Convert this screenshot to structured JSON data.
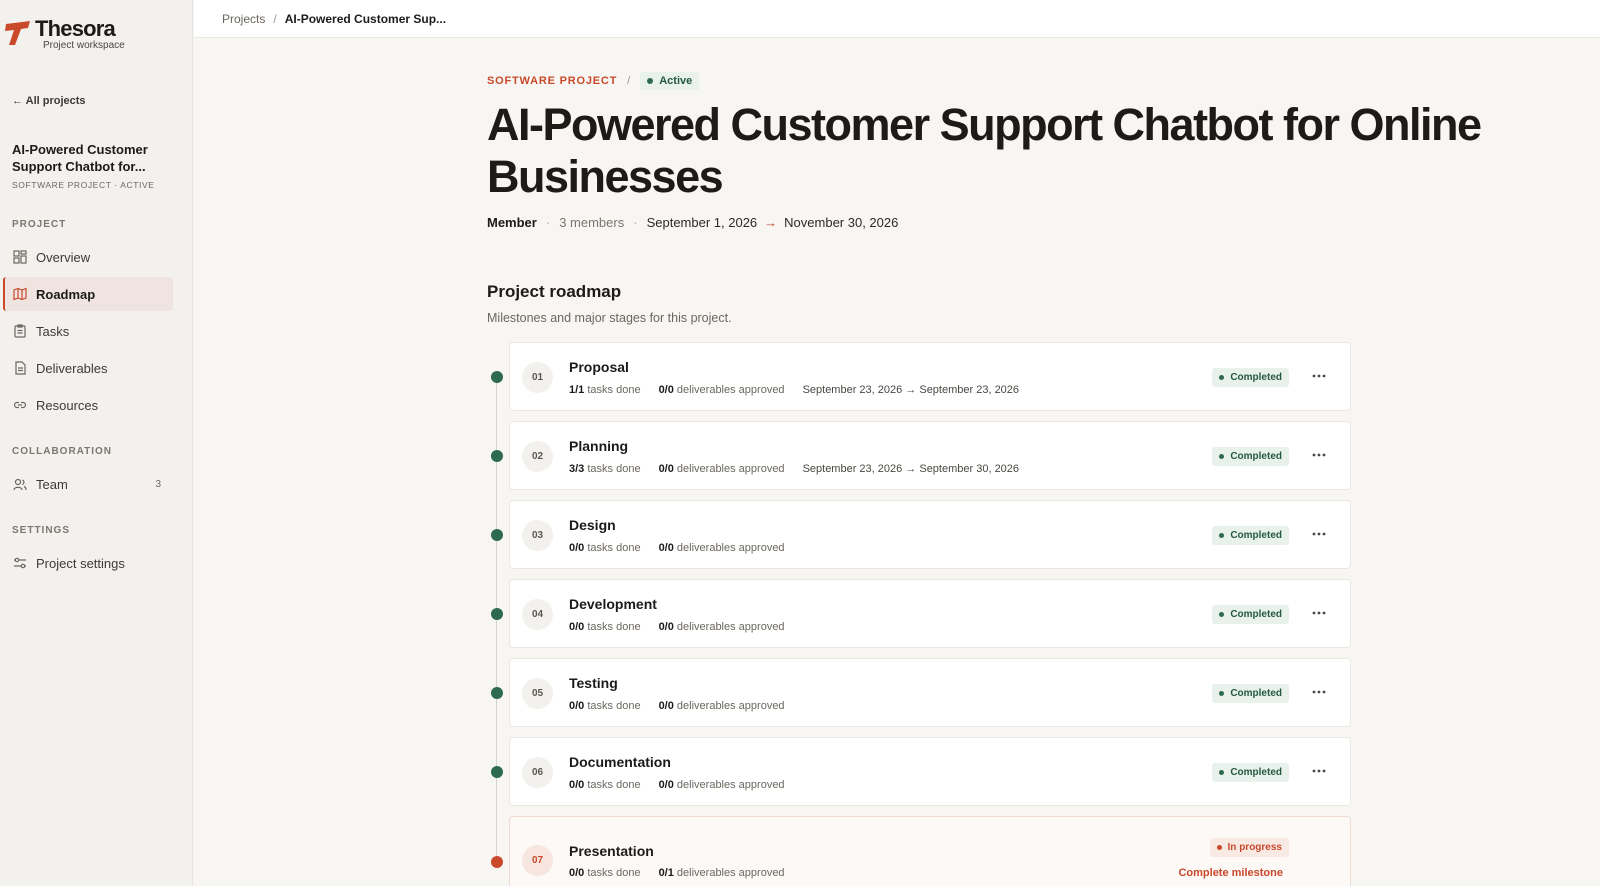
{
  "brand": {
    "name": "Thesora",
    "subtitle": "Project workspace",
    "accent": "#c9492b"
  },
  "sidebar": {
    "back_label": "← All projects",
    "project_title": "AI-Powered Customer Support Chatbot for...",
    "project_meta": "SOFTWARE PROJECT · ACTIVE",
    "sections": {
      "project": "PROJECT",
      "collaboration": "COLLABORATION",
      "settings": "SETTINGS"
    },
    "items": {
      "overview": "Overview",
      "roadmap": "Roadmap",
      "tasks": "Tasks",
      "deliverables": "Deliverables",
      "resources": "Resources",
      "team": "Team",
      "team_count": "3",
      "project_settings": "Project settings"
    }
  },
  "breadcrumb": {
    "root": "Projects",
    "separator": "/",
    "current": "AI-Powered Customer Sup..."
  },
  "header": {
    "type": "SOFTWARE PROJECT",
    "separator": "/",
    "status": "Active",
    "title": "AI-Powered Customer Support Chatbot for Online Businesses",
    "role": "Member",
    "members": "3 members",
    "start_date": "September 1, 2026",
    "arrow": "→",
    "end_date": "November 30, 2026"
  },
  "roadmap": {
    "title": "Project roadmap",
    "subtitle": "Milestones and major stages for this project.",
    "tasks_suffix": "tasks done",
    "deliverables_suffix": "deliverables approved",
    "complete_label": "Complete milestone",
    "milestones": [
      {
        "num": "01",
        "title": "Proposal",
        "tasks": "1/1",
        "deliverables": "0/0",
        "dates": "September 23, 2026 → September 23, 2026",
        "status": "Completed"
      },
      {
        "num": "02",
        "title": "Planning",
        "tasks": "3/3",
        "deliverables": "0/0",
        "dates": "September 23, 2026 → September 30, 2026",
        "status": "Completed"
      },
      {
        "num": "03",
        "title": "Design",
        "tasks": "0/0",
        "deliverables": "0/0",
        "dates": "",
        "status": "Completed"
      },
      {
        "num": "04",
        "title": "Development",
        "tasks": "0/0",
        "deliverables": "0/0",
        "dates": "",
        "status": "Completed"
      },
      {
        "num": "05",
        "title": "Testing",
        "tasks": "0/0",
        "deliverables": "0/0",
        "dates": "",
        "status": "Completed"
      },
      {
        "num": "06",
        "title": "Documentation",
        "tasks": "0/0",
        "deliverables": "0/0",
        "dates": "",
        "status": "Completed"
      },
      {
        "num": "07",
        "title": "Presentation",
        "tasks": "0/0",
        "deliverables": "0/1",
        "dates": "",
        "status": "In progress"
      }
    ]
  },
  "colors": {
    "completed": "#2d6a4f",
    "in_progress": "#c9492b"
  },
  "icons": [
    "logo-icon",
    "overview-icon",
    "roadmap-icon",
    "tasks-icon",
    "deliverables-icon",
    "resources-icon",
    "team-icon",
    "settings-icon",
    "more-icon"
  ]
}
